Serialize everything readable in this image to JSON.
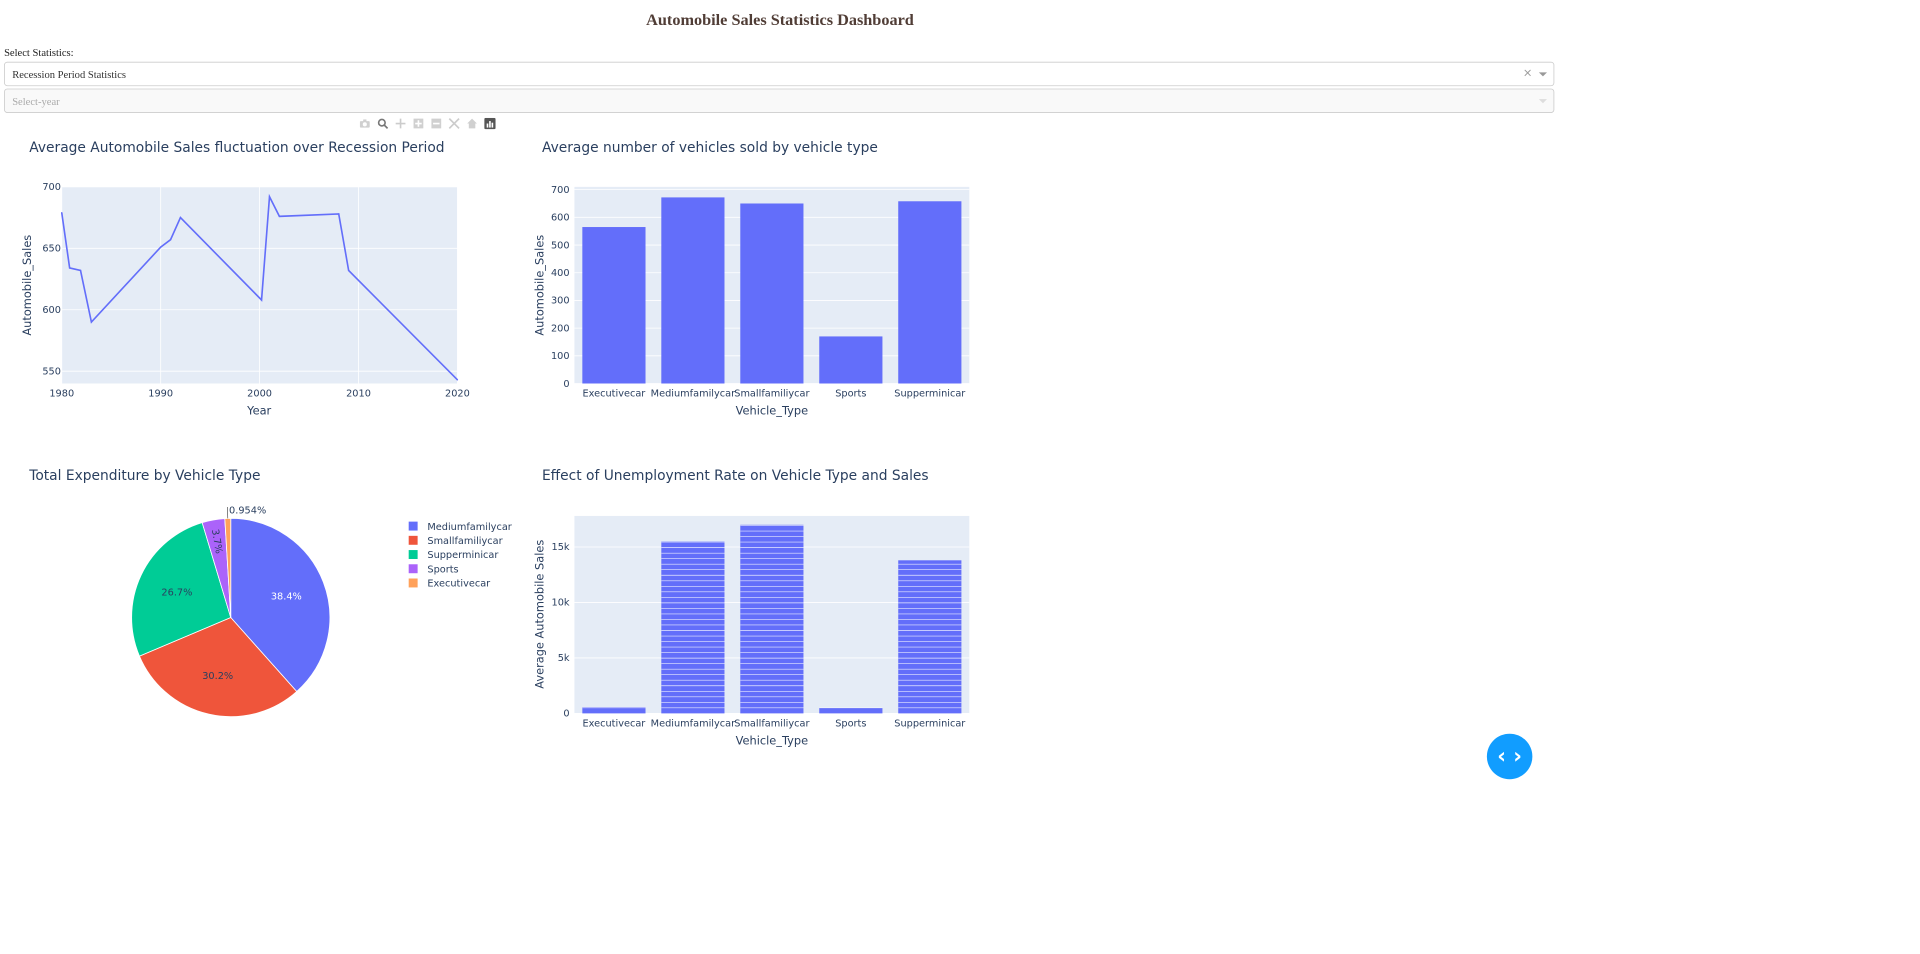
{
  "header": {
    "title": "Automobile Sales Statistics Dashboard"
  },
  "controls": {
    "label": "Select Statistics:",
    "statistics_value": "Recession Period Statistics",
    "clear_symbol": "×",
    "year_placeholder": "Select-year"
  },
  "modebar": [
    "camera-icon",
    "zoom-icon",
    "pan-icon",
    "zoom-in-icon",
    "zoom-out-icon",
    "autoscale-icon",
    "reset-axes-icon",
    "plotly-logo-icon"
  ],
  "fab": {
    "label": "‹ ›",
    "color": "#119DFF"
  },
  "colors": {
    "plot_bg": "#E5ECF6",
    "series": "#636EFA",
    "text": "#2a3f5f",
    "title": "#503D36"
  },
  "chart_data": [
    {
      "type": "line",
      "title": "Average Automobile Sales fluctuation over Recession Period",
      "xlabel": "Year",
      "ylabel": "Automobile_Sales",
      "xlim": [
        1980,
        2020
      ],
      "ylim": [
        540,
        700
      ],
      "x_ticks": [
        "1980",
        "1990",
        "2000",
        "2010",
        "2020"
      ],
      "y_ticks": [
        "550",
        "600",
        "650",
        "700"
      ],
      "x": [
        1980,
        1980.8,
        1981.9,
        1983,
        1990,
        1991,
        1992,
        2000.2,
        2001,
        2002,
        2008,
        2009,
        2020
      ],
      "y": [
        679,
        634,
        632,
        590,
        651,
        657,
        675,
        608,
        692,
        676,
        678,
        632,
        543
      ],
      "grid": true
    },
    {
      "type": "bar",
      "title": "Average number of vehicles sold by vehicle type",
      "xlabel": "Vehicle_Type",
      "ylabel": "Automobile_Sales",
      "ylim": [
        0,
        710
      ],
      "y_ticks": [
        "0",
        "100",
        "200",
        "300",
        "400",
        "500",
        "600",
        "700"
      ],
      "categories": [
        "Executivecar",
        "Mediumfamilycar",
        "Smallfamiliycar",
        "Sports",
        "Supperminicar"
      ],
      "values": [
        565,
        672,
        650,
        170,
        658
      ],
      "grid": true
    },
    {
      "type": "pie",
      "title": "Total Expenditure by Vehicle Type",
      "labels": [
        "Mediumfamilycar",
        "Smallfamiliycar",
        "Supperminicar",
        "Sports",
        "Executivecar"
      ],
      "values": [
        38.4,
        30.2,
        26.7,
        3.7,
        0.954
      ],
      "text": [
        "38.4%",
        "30.2%",
        "26.7%",
        "3.7%",
        "0.954%"
      ],
      "colors": [
        "#636EFA",
        "#EF553B",
        "#00CC96",
        "#AB63FA",
        "#FFA15A"
      ],
      "legend": "right"
    },
    {
      "type": "bar",
      "title": "Effect of Unemployment Rate on Vehicle Type and Sales",
      "xlabel": "Vehicle_Type",
      "ylabel": "Average Automobile Sales",
      "ylim": [
        0,
        17800
      ],
      "y_ticks": [
        "0",
        "5k",
        "10k",
        "15k"
      ],
      "categories": [
        "Executivecar",
        "Mediumfamilycar",
        "Smallfamiliycar",
        "Sports",
        "Supperminicar"
      ],
      "values": [
        565,
        15500,
        17000,
        500,
        13800
      ],
      "stacked_segments": true,
      "grid": true
    }
  ]
}
